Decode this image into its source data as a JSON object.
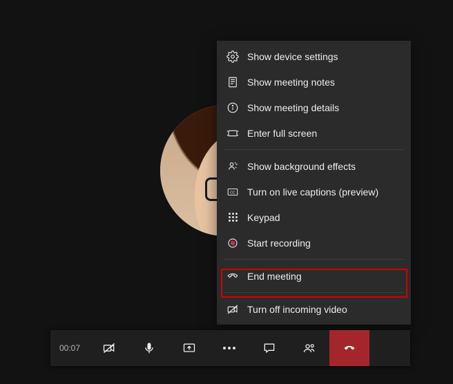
{
  "participant": {
    "avatar_description": "Woman with brown hair and black-rimmed glasses"
  },
  "menu": {
    "items": [
      {
        "label": "Show device settings",
        "icon": "gear-icon"
      },
      {
        "label": "Show meeting notes",
        "icon": "notes-icon"
      },
      {
        "label": "Show meeting details",
        "icon": "info-icon"
      },
      {
        "label": "Enter full screen",
        "icon": "fullscreen-icon"
      }
    ],
    "group2": [
      {
        "label": "Show background effects",
        "icon": "background-effects-icon"
      },
      {
        "label": "Turn on live captions (preview)",
        "icon": "captions-icon"
      },
      {
        "label": "Keypad",
        "icon": "keypad-icon"
      },
      {
        "label": "Start recording",
        "icon": "record-icon"
      }
    ],
    "group3": [
      {
        "label": "End meeting",
        "icon": "phone-hangup-icon"
      }
    ],
    "group4": [
      {
        "label": "Turn off incoming video",
        "icon": "video-off-icon"
      }
    ],
    "highlighted_index": "End meeting"
  },
  "call_bar": {
    "timer": "00:07",
    "buttons": {
      "camera_muted": "Camera off",
      "mic": "Microphone",
      "share": "Share screen",
      "more": "More actions",
      "chat": "Show conversation",
      "participants": "Show participants",
      "hangup": "Hang up"
    }
  }
}
